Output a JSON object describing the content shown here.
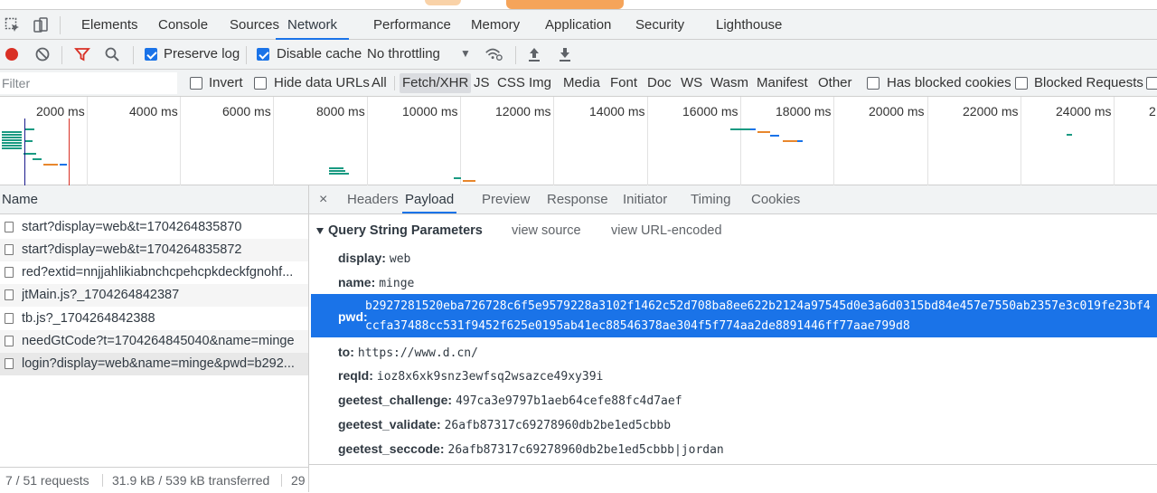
{
  "main_tabs": [
    "Elements",
    "Console",
    "Sources",
    "Network",
    "Performance",
    "Memory",
    "Application",
    "Security",
    "Lighthouse"
  ],
  "active_tab": "Network",
  "toolbar": {
    "preserve_log": "Preserve log",
    "disable_cache": "Disable cache",
    "throttling": "No throttling",
    "throttle_arrow": "▼"
  },
  "filter": {
    "placeholder": "Filter",
    "invert": "Invert",
    "hide_data_urls": "Hide data URLs",
    "types": [
      "All",
      "Fetch/XHR",
      "JS",
      "CSS",
      "Img",
      "Media",
      "Font",
      "Doc",
      "WS",
      "Wasm",
      "Manifest",
      "Other"
    ],
    "selected_type": "Fetch/XHR",
    "has_blocked_cookies": "Has blocked cookies",
    "blocked_requests": "Blocked Requests"
  },
  "timeline": {
    "ticks": [
      "2000 ms",
      "4000 ms",
      "6000 ms",
      "8000 ms",
      "10000 ms",
      "12000 ms",
      "14000 ms",
      "16000 ms",
      "18000 ms",
      "20000 ms",
      "22000 ms",
      "24000 ms",
      "2"
    ]
  },
  "requests": {
    "header": "Name",
    "items": [
      "start?display=web&t=1704264835870",
      "start?display=web&t=1704264835872",
      "red?extid=nnjjahlikiabnchcpehcpkdeckfgnohf...",
      "jtMain.js?_1704264842387",
      "tb.js?_1704264842388",
      "needGtCode?t=1704264845040&name=minge",
      "login?display=web&name=minge&pwd=b292..."
    ],
    "status": {
      "count": "7 / 51 requests",
      "size": "31.9 kB / 539 kB transferred",
      "extra": "29"
    }
  },
  "detail": {
    "close": "×",
    "tabs": [
      "Headers",
      "Payload",
      "Preview",
      "Response",
      "Initiator",
      "Timing",
      "Cookies"
    ],
    "active_tab": "Payload",
    "section_title": "Query String Parameters",
    "view_source": "view source",
    "view_url_encoded": "view URL-encoded",
    "params": [
      {
        "key": "display:",
        "value": "web"
      },
      {
        "key": "name:",
        "value": "minge"
      },
      {
        "key": "pwd:",
        "value_line1": "b2927281520eba726728c6f5e9579228a3102f1462c52d708ba8ee622b2124a97545d0e3a6d0315bd84e457e7550ab2357e3c019fe23bf4",
        "value_line2": "ccfa37488cc531f9452f625e0195ab41ec88546378ae304f5f774aa2de8891446ff77aae799d8"
      },
      {
        "key": "to:",
        "value": "https://www.d.cn/"
      },
      {
        "key": "reqId:",
        "value": "ioz8x6xk9snz3ewfsq2wsazce49xy39i"
      },
      {
        "key": "geetest_challenge:",
        "value": "497ca3e9797b1aeb64cefe88fc4d7aef"
      },
      {
        "key": "geetest_validate:",
        "value": "26afb87317c69278960db2be1ed5cbbb"
      },
      {
        "key": "geetest_seccode:",
        "value": "26afb87317c69278960db2be1ed5cbbb|jordan"
      }
    ]
  },
  "colors": {
    "accent": "#1a73e8",
    "record": "#d93025",
    "filter_icon": "#d93025"
  }
}
